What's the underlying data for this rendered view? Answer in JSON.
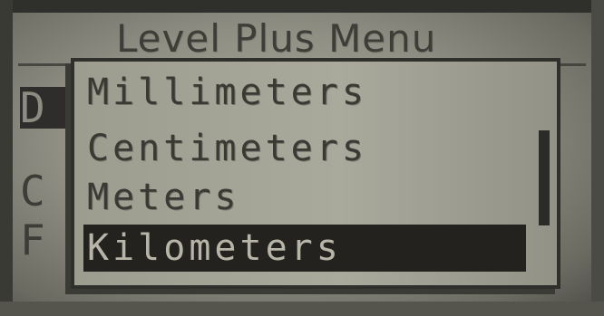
{
  "header": {
    "title": "Level Plus Menu"
  },
  "background_list": {
    "items": [
      {
        "letter": "D",
        "selected": true
      },
      {
        "letter": "C",
        "selected": false
      },
      {
        "letter": "F",
        "selected": false
      }
    ]
  },
  "units_menu": {
    "items": [
      {
        "label": "Millimeters",
        "selected": false
      },
      {
        "label": "Centimeters",
        "selected": false
      },
      {
        "label": "Meters",
        "selected": false
      },
      {
        "label": "Kilometers",
        "selected": true
      }
    ],
    "scroll_position": 0.5
  },
  "colors": {
    "lcd_background": "#a3a396",
    "lcd_text": "#3a3a35",
    "highlight_background": "#24221f",
    "highlight_text": "#b7b5a8"
  }
}
